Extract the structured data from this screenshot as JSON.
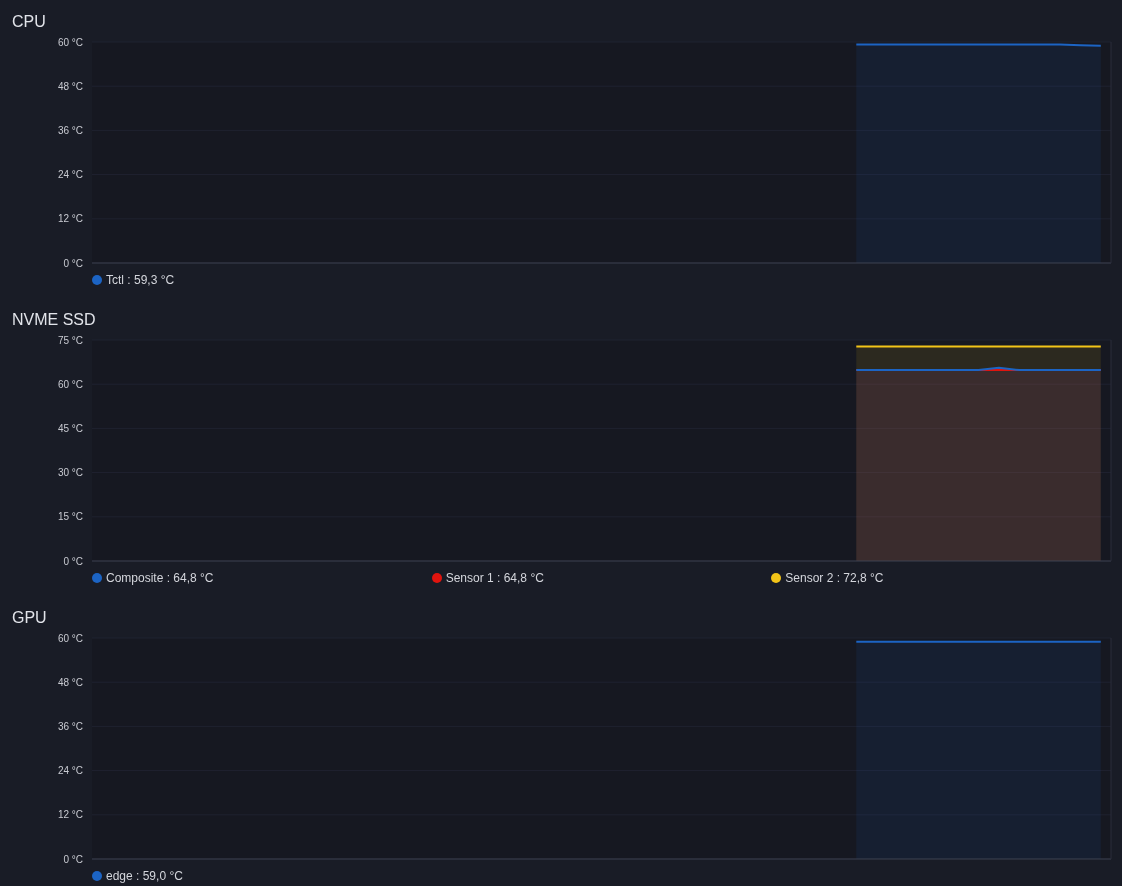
{
  "panels": [
    {
      "title": "CPU",
      "chart_data": {
        "type": "area",
        "grid": true,
        "categories": [
          null,
          null,
          null,
          null,
          null,
          null,
          null,
          null,
          null,
          null,
          null,
          null,
          null,
          null,
          null,
          null,
          null,
          null,
          null,
          null,
          null,
          null,
          null,
          null,
          null,
          null,
          null,
          null,
          null,
          null,
          null,
          null,
          null,
          null,
          null,
          null,
          null,
          null,
          null,
          null,
          null,
          null,
          null,
          null,
          null,
          null,
          null,
          null,
          null,
          null
        ],
        "ylim": [
          0,
          60
        ],
        "yticks": [
          {
            "value": 0,
            "label": "0 °C"
          },
          {
            "value": 12,
            "label": "12 °C"
          },
          {
            "value": 24,
            "label": "24 °C"
          },
          {
            "value": 36,
            "label": "36 °C"
          },
          {
            "value": 48,
            "label": "48 °C"
          },
          {
            "value": 60,
            "label": "60 °C"
          }
        ],
        "series": [
          {
            "name": "Tctl",
            "color": "#1c64c4",
            "values": [
              null,
              null,
              null,
              null,
              null,
              null,
              null,
              null,
              null,
              null,
              null,
              null,
              null,
              null,
              null,
              null,
              null,
              null,
              null,
              null,
              null,
              null,
              null,
              null,
              null,
              null,
              null,
              null,
              null,
              null,
              null,
              null,
              null,
              null,
              null,
              null,
              null,
              59.3,
              59.3,
              59.3,
              59.3,
              59.3,
              59.3,
              59.3,
              59.3,
              59.3,
              59.3,
              59.3,
              59.1,
              59.0
            ]
          }
        ]
      },
      "legend": [
        ": 59,3 °C"
      ]
    },
    {
      "title": "NVME SSD",
      "chart_data": {
        "type": "area",
        "grid": true,
        "categories": [
          null,
          null,
          null,
          null,
          null,
          null,
          null,
          null,
          null,
          null,
          null,
          null,
          null,
          null,
          null,
          null,
          null,
          null,
          null,
          null,
          null,
          null,
          null,
          null,
          null,
          null,
          null,
          null,
          null,
          null,
          null,
          null,
          null,
          null,
          null,
          null,
          null,
          null,
          null,
          null,
          null,
          null,
          null,
          null,
          null,
          null,
          null,
          null,
          null,
          null
        ],
        "ylim": [
          0,
          75
        ],
        "yticks": [
          {
            "value": 0,
            "label": "0 °C"
          },
          {
            "value": 15,
            "label": "15 °C"
          },
          {
            "value": 30,
            "label": "30 °C"
          },
          {
            "value": 45,
            "label": "45 °C"
          },
          {
            "value": 60,
            "label": "60 °C"
          },
          {
            "value": 75,
            "label": "75 °C"
          }
        ],
        "series": [
          {
            "name": "Composite",
            "color": "#1c64c4",
            "values": [
              null,
              null,
              null,
              null,
              null,
              null,
              null,
              null,
              null,
              null,
              null,
              null,
              null,
              null,
              null,
              null,
              null,
              null,
              null,
              null,
              null,
              null,
              null,
              null,
              null,
              null,
              null,
              null,
              null,
              null,
              null,
              null,
              null,
              null,
              null,
              null,
              null,
              64.8,
              64.8,
              64.8,
              64.8,
              64.8,
              64.8,
              64.8,
              65.6,
              64.8,
              64.8,
              64.8,
              64.8,
              64.8
            ]
          },
          {
            "name": "Sensor 1",
            "color": "#e0140e",
            "values": [
              null,
              null,
              null,
              null,
              null,
              null,
              null,
              null,
              null,
              null,
              null,
              null,
              null,
              null,
              null,
              null,
              null,
              null,
              null,
              null,
              null,
              null,
              null,
              null,
              null,
              null,
              null,
              null,
              null,
              null,
              null,
              null,
              null,
              null,
              null,
              null,
              null,
              64.8,
              64.8,
              64.8,
              64.8,
              64.8,
              64.8,
              64.8,
              64.8,
              64.8,
              64.8,
              64.8,
              64.8,
              64.8
            ]
          },
          {
            "name": "Sensor 2",
            "color": "#f2c418",
            "values": [
              null,
              null,
              null,
              null,
              null,
              null,
              null,
              null,
              null,
              null,
              null,
              null,
              null,
              null,
              null,
              null,
              null,
              null,
              null,
              null,
              null,
              null,
              null,
              null,
              null,
              null,
              null,
              null,
              null,
              null,
              null,
              null,
              null,
              null,
              null,
              null,
              null,
              72.8,
              72.8,
              72.8,
              72.8,
              72.8,
              72.8,
              72.8,
              72.8,
              72.8,
              72.8,
              72.8,
              72.8,
              72.8
            ]
          }
        ]
      },
      "legend": [
        ": 64,8 °C",
        ": 64,8 °C",
        ": 72,8 °C"
      ]
    },
    {
      "title": "GPU",
      "chart_data": {
        "type": "area",
        "grid": true,
        "categories": [
          null,
          null,
          null,
          null,
          null,
          null,
          null,
          null,
          null,
          null,
          null,
          null,
          null,
          null,
          null,
          null,
          null,
          null,
          null,
          null,
          null,
          null,
          null,
          null,
          null,
          null,
          null,
          null,
          null,
          null,
          null,
          null,
          null,
          null,
          null,
          null,
          null,
          null,
          null,
          null,
          null,
          null,
          null,
          null,
          null,
          null,
          null,
          null,
          null,
          null
        ],
        "ylim": [
          0,
          60
        ],
        "yticks": [
          {
            "value": 0,
            "label": "0 °C"
          },
          {
            "value": 12,
            "label": "12 °C"
          },
          {
            "value": 24,
            "label": "24 °C"
          },
          {
            "value": 36,
            "label": "36 °C"
          },
          {
            "value": 48,
            "label": "48 °C"
          },
          {
            "value": 60,
            "label": "60 °C"
          }
        ],
        "series": [
          {
            "name": "edge",
            "color": "#1c64c4",
            "values": [
              null,
              null,
              null,
              null,
              null,
              null,
              null,
              null,
              null,
              null,
              null,
              null,
              null,
              null,
              null,
              null,
              null,
              null,
              null,
              null,
              null,
              null,
              null,
              null,
              null,
              null,
              null,
              null,
              null,
              null,
              null,
              null,
              null,
              null,
              null,
              null,
              null,
              59.0,
              59.0,
              59.0,
              59.0,
              59.0,
              59.0,
              59.0,
              59.0,
              59.0,
              59.0,
              59.0,
              59.0,
              59.0
            ]
          }
        ]
      },
      "legend": [
        ": 59,0 °C"
      ]
    }
  ]
}
